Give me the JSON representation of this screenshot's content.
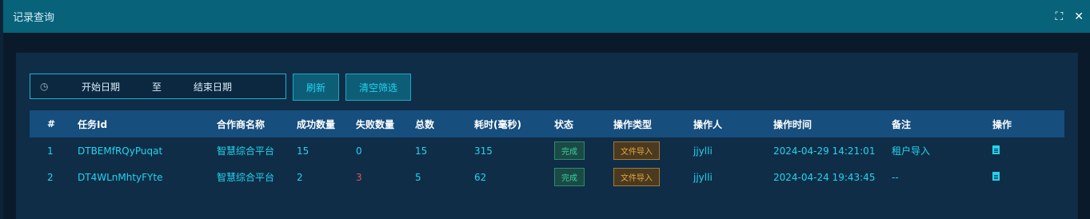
{
  "window": {
    "title": "记录查询",
    "icons": [
      "fullscreen-icon",
      "close-icon"
    ]
  },
  "filters": {
    "date_start_placeholder": "开始日期",
    "date_separator": "至",
    "date_end_placeholder": "结束日期",
    "refresh_label": "刷新",
    "clear_label": "清空筛选"
  },
  "table": {
    "headers": [
      "#",
      "任务Id",
      "合作商名称",
      "成功数量",
      "失败数量",
      "总数",
      "耗时(毫秒)",
      "状态",
      "操作类型",
      "操作人",
      "操作时间",
      "备注",
      "操作"
    ],
    "rows": [
      {
        "index": "1",
        "task_id": "DTBEMfRQyPuqat",
        "partner": "智慧综合平台",
        "success": "15",
        "fail": "0",
        "total": "15",
        "duration": "315",
        "status": "完成",
        "op_type": "文件导入",
        "operator": "jjylli",
        "op_time": "2024-04-29 14:21:01",
        "remark": "租户导入"
      },
      {
        "index": "2",
        "task_id": "DT4WLnMhtyFYte",
        "partner": "智慧综合平台",
        "success": "2",
        "fail": "3",
        "total": "5",
        "duration": "62",
        "status": "完成",
        "op_type": "文件导入",
        "operator": "jjylli",
        "op_time": "2024-04-24 19:43:45",
        "remark": "--"
      }
    ]
  },
  "colors": {
    "accent": "#22d4ef",
    "header_bg": "#164e7d",
    "fail_highlight": "#e05555",
    "status_done": "#3ad09a",
    "op_type": "#e9a63d"
  }
}
